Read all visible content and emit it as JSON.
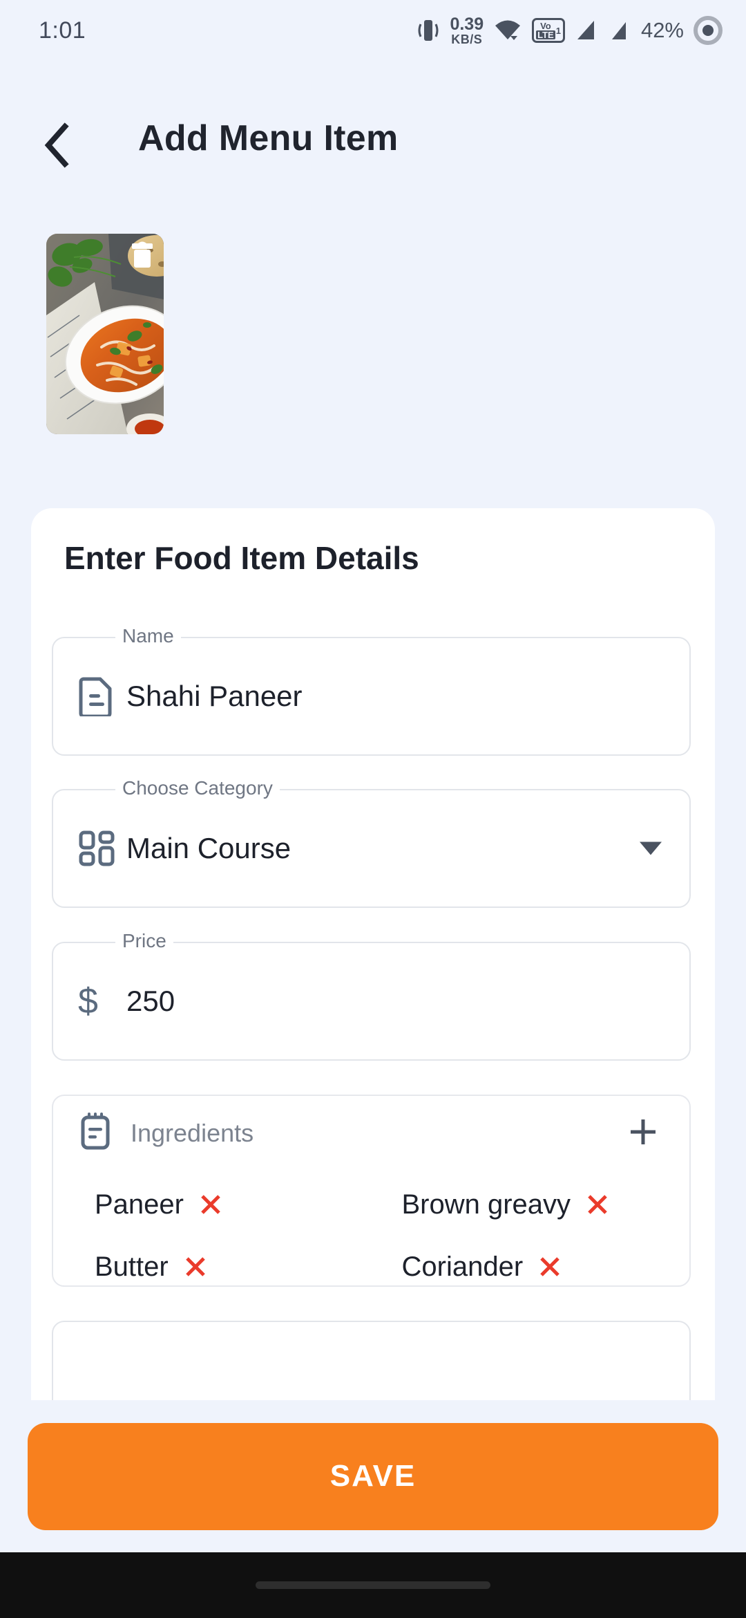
{
  "statusbar": {
    "time": "1:01",
    "net_speed_value": "0.39",
    "net_speed_unit": "KB/S",
    "volte_top": "Vo",
    "volte_bottom": "LTE",
    "volte_sim": "1",
    "battery": "42%",
    "icons": [
      "vibrate-icon",
      "wifi-icon",
      "volte-icon",
      "signal-icon-1",
      "signal-icon-2",
      "record-icon"
    ]
  },
  "appbar": {
    "back_icon": "back-chevron-icon",
    "title": "Add Menu Item"
  },
  "image": {
    "delete_icon": "trash-icon",
    "alt": "food-photo-shahi-paneer"
  },
  "form": {
    "heading": "Enter Food Item Details",
    "name": {
      "label": "Name",
      "value": "Shahi Paneer",
      "icon": "document-icon"
    },
    "category": {
      "label": "Choose Category",
      "value": "Main Course",
      "icon": "grid-icon",
      "caret_icon": "chevron-down-icon"
    },
    "price": {
      "label": "Price",
      "value": "250",
      "icon": "dollar-icon",
      "currency_symbol": "$"
    },
    "ingredients": {
      "label": "Ingredients",
      "icon": "clipboard-icon",
      "add_icon": "plus-icon",
      "remove_icon": "close-icon",
      "items": [
        "Paneer",
        "Brown greavy",
        "Butter",
        "Coriander"
      ]
    }
  },
  "footer": {
    "save_label": "SAVE",
    "save_color": "#f8801e"
  },
  "colors": {
    "background": "#eff3fc",
    "card": "#ffffff",
    "accent": "#f8801e",
    "icon": "#5b6b7f",
    "remove": "#ea3b2b",
    "text": "#1d212b",
    "muted": "#6f7683"
  }
}
